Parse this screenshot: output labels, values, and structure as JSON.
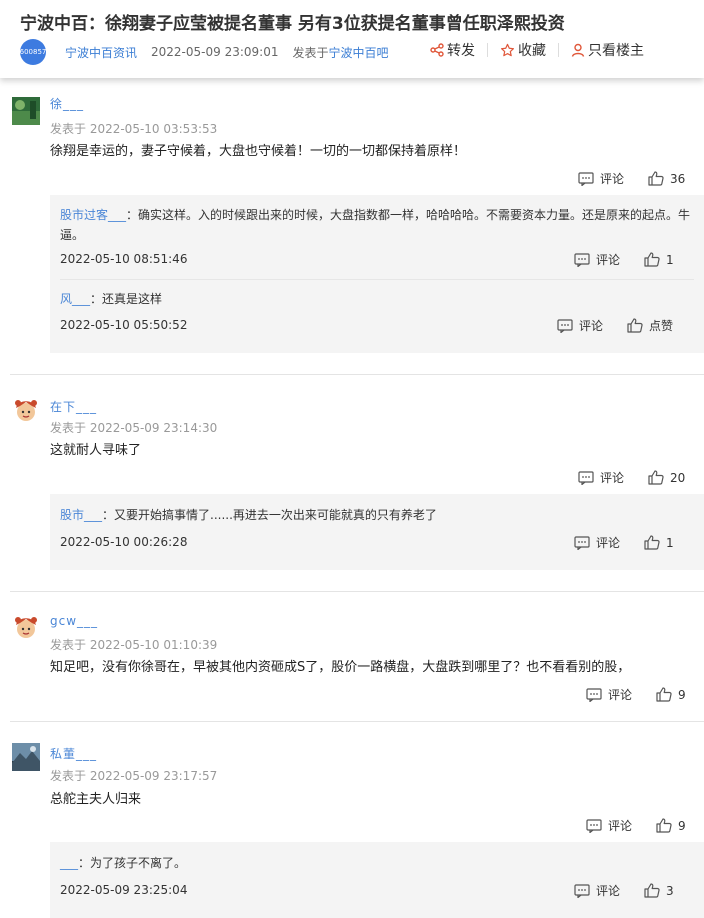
{
  "header": {
    "title": "宁波中百：徐翔妻子应莹被提名董事 另有3位获提名董事曾任职泽熙投资",
    "stock_code": "600857",
    "source": "宁波中百资讯",
    "datetime": "2022-05-09 23:09:01",
    "posted_in_prefix": "发表于",
    "posted_in_forum": "宁波中百吧",
    "share_label": "转发",
    "favorite_label": "收藏",
    "only_author_label": "只看楼主"
  },
  "posts": [
    {
      "username": "徐___",
      "time": "发表于 2022-05-10 03:53:53",
      "text": "徐翔是幸运的，妻子守候着，大盘也守候着！一切的一切都保持着原样！",
      "comment_label": "评论",
      "likes": "36",
      "replies": [
        {
          "name": "股市过客___",
          "text": "：确实这样。入的时候跟出来的时候，大盘指数都一样，哈哈哈哈。不需要资本力量。还是原来的起点。牛逼。",
          "time": "2022-05-10 08:51:46",
          "comment_label": "评论",
          "likes": "1"
        },
        {
          "name": "风___",
          "text": "：还真是这样",
          "time": "2022-05-10 05:50:52",
          "comment_label": "评论",
          "likes": "点赞"
        }
      ]
    },
    {
      "username": "在下___",
      "time": "发表于 2022-05-09 23:14:30",
      "text": "这就耐人寻味了",
      "comment_label": "评论",
      "likes": "20",
      "replies": [
        {
          "name": "股市___",
          "text": "：又要开始搞事情了......再进去一次出来可能就真的只有养老了",
          "time": "2022-05-10 00:26:28",
          "comment_label": "评论",
          "likes": "1"
        }
      ]
    },
    {
      "username": "gcw___",
      "time": "发表于 2022-05-10 01:10:39",
      "text": "知足吧，没有你徐哥在，早被其他内资砸成S了，股价一路横盘，大盘跌到哪里了？也不看看别的股，",
      "comment_label": "评论",
      "likes": "9",
      "replies": []
    },
    {
      "username": "私董___",
      "time": "发表于 2022-05-09 23:17:57",
      "text": "总舵主夫人归来",
      "comment_label": "评论",
      "likes": "9",
      "replies": [
        {
          "name": "___",
          "text": "：为了孩子不离了。",
          "time": "2022-05-09 23:25:04",
          "comment_label": "评论",
          "likes": "3"
        }
      ]
    }
  ]
}
